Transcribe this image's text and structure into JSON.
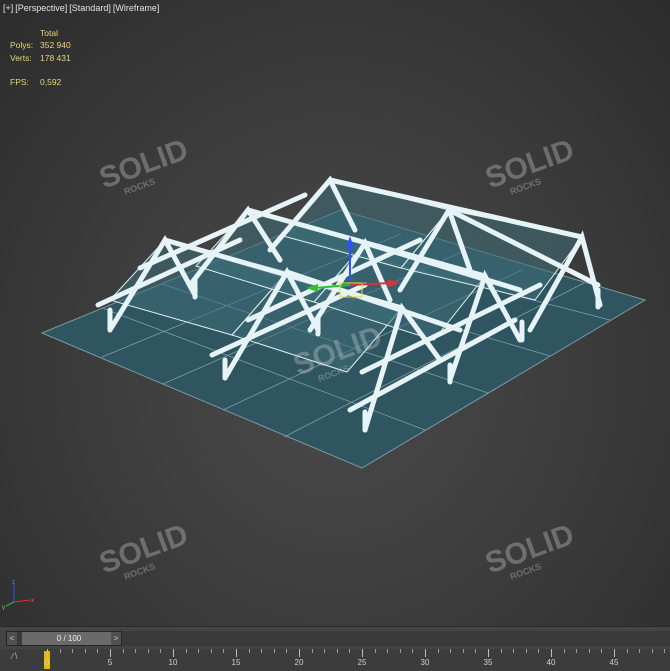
{
  "viewport": {
    "labels": [
      "[+]",
      "[Perspective]",
      "[Standard]",
      "[Wireframe]"
    ]
  },
  "stats": {
    "header": "Total",
    "polys_label": "Polys:",
    "polys_value": "352 940",
    "verts_label": "Verts:",
    "verts_value": "178 431",
    "fps_label": "FPS:",
    "fps_value": "0,592"
  },
  "watermark": {
    "main": "SOLID",
    "sub": "ROCKS"
  },
  "timeline": {
    "prev_label": "<",
    "next_label": ">",
    "frame_label": "0 / 100",
    "ruler_ticks": [
      "0",
      "5",
      "10",
      "15",
      "20",
      "25",
      "30",
      "35",
      "40",
      "45"
    ],
    "current_frame": 0
  },
  "colors": {
    "ground": "#2f5560",
    "structure": "#e6f4f8",
    "panel": "#3e6e78",
    "stats": "#e8d870",
    "axis_x": "#e03030",
    "axis_y": "#30c030",
    "axis_z": "#3050ff"
  },
  "icons": {
    "axis_tripod": "xyz-axis-icon",
    "gizmo": "transform-gizmo-icon"
  }
}
